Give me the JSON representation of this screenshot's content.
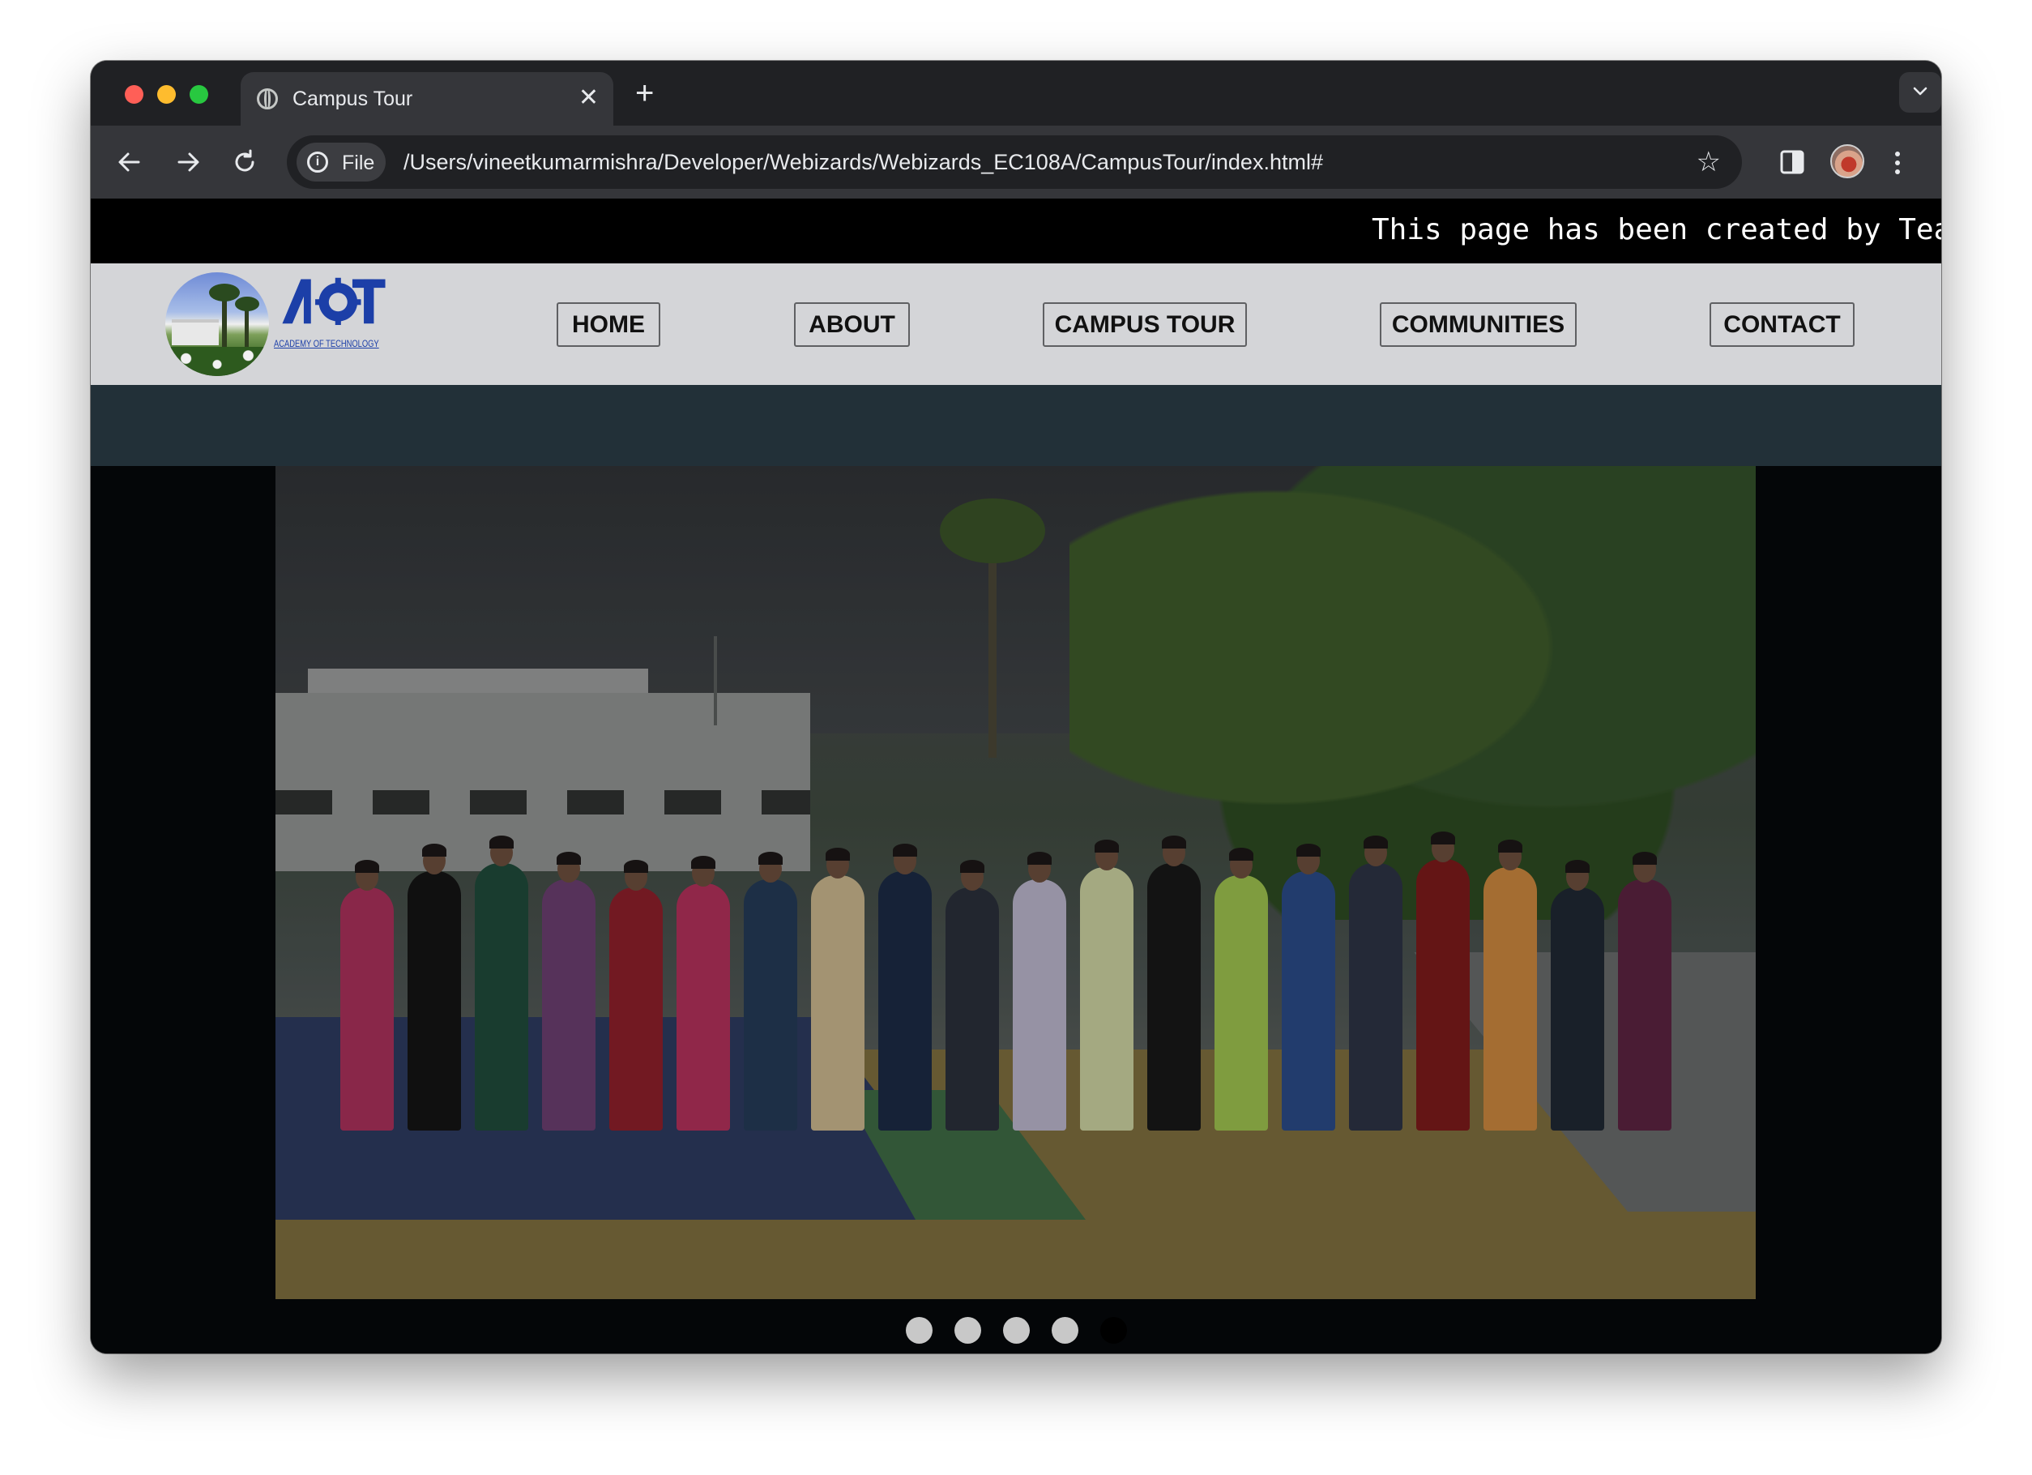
{
  "browser": {
    "tab_title": "Campus Tour",
    "tab_close": "✕",
    "new_tab": "+",
    "site_chip": "File",
    "url": "/Users/vineetkumarmishra/Developer/Webizards/Webizards_EC108A/CampusTour/index.html#"
  },
  "page": {
    "marquee": "This page has been created by Team",
    "logo": {
      "wordmark": "AOT",
      "subtitle": "ACADEMY OF TECHNOLOGY"
    },
    "nav": [
      {
        "label": "HOME"
      },
      {
        "label": "ABOUT"
      },
      {
        "label": "CAMPUS TOUR"
      },
      {
        "label": "COMMUNITIES"
      },
      {
        "label": "CONTACT"
      }
    ],
    "slider": {
      "slide_count": 5,
      "active_index": 4
    }
  },
  "colors": {
    "nav_bg": "#d4d5d8",
    "band": "#223038",
    "page_bg": "#040608",
    "logo_blue": "#1c3fa8"
  },
  "icons": [
    "globe-icon",
    "close-icon",
    "plus-icon",
    "chevron-down-icon",
    "back-arrow-icon",
    "forward-arrow-icon",
    "reload-icon",
    "info-icon",
    "star-icon",
    "side-panel-icon",
    "profile-avatar",
    "kebab-menu-icon"
  ]
}
